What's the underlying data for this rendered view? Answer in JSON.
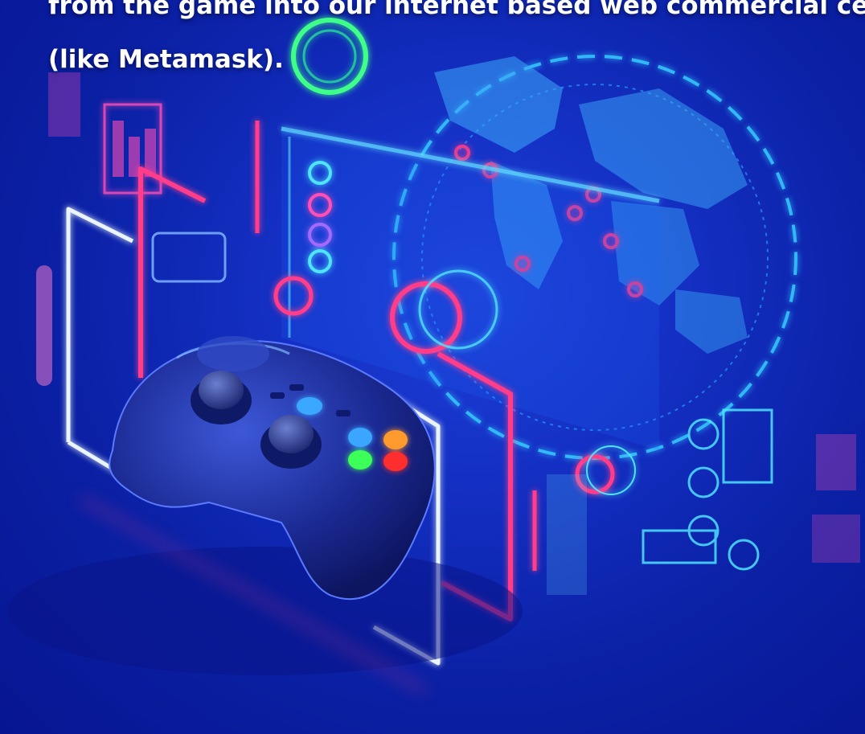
{
  "caption": {
    "line1": "from the game into our internet based web commercial center",
    "line2": "(like Metamask)."
  },
  "colors": {
    "background": "#0b21a6",
    "neon_pink": "#ff3d8b",
    "neon_cyan": "#4fe3ff",
    "neon_white": "#e9f4ff",
    "neon_green": "#3dff8a",
    "controller": "#1a2a8c"
  }
}
